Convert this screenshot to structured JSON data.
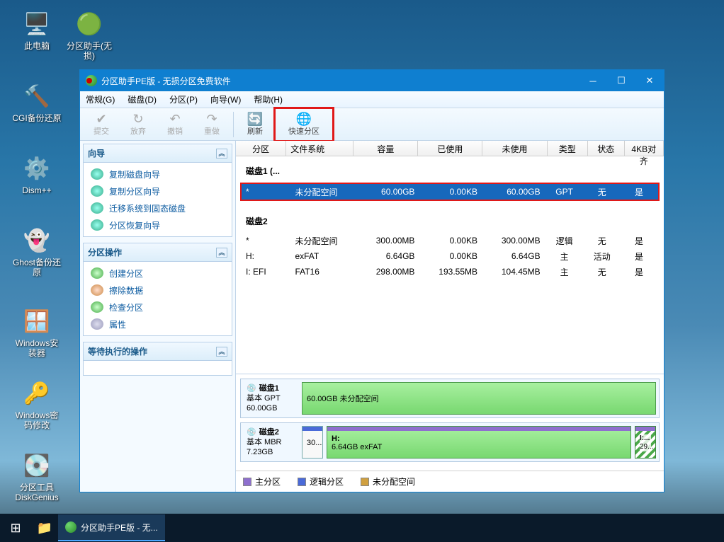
{
  "desktop": {
    "icons": [
      {
        "label": "此电脑"
      },
      {
        "label": "分区助手(无损)"
      },
      {
        "label": "CGI备份还原"
      },
      {
        "label": "Dism++"
      },
      {
        "label": "Ghost备份还原"
      },
      {
        "label": "Windows安装器"
      },
      {
        "label": "Windows密码修改"
      },
      {
        "label": "分区工具DiskGenius"
      }
    ]
  },
  "window": {
    "title": "分区助手PE版 - 无损分区免费软件"
  },
  "menu": {
    "m0": "常规(G)",
    "m1": "磁盘(D)",
    "m2": "分区(P)",
    "m3": "向导(W)",
    "m4": "帮助(H)"
  },
  "toolbar": {
    "commit": "提交",
    "discard": "放弃",
    "undo": "撤销",
    "redo": "重做",
    "refresh": "刷新",
    "quick": "快速分区"
  },
  "left": {
    "wizard": {
      "title": "向导",
      "i0": "复制磁盘向导",
      "i1": "复制分区向导",
      "i2": "迁移系统到固态磁盘",
      "i3": "分区恢复向导"
    },
    "ops": {
      "title": "分区操作",
      "i0": "创建分区",
      "i1": "擦除数据",
      "i2": "检查分区",
      "i3": "属性"
    },
    "pending": {
      "title": "等待执行的操作"
    }
  },
  "cols": {
    "c0": "分区",
    "c1": "文件系统",
    "c2": "容量",
    "c3": "已使用",
    "c4": "未使用",
    "c5": "类型",
    "c6": "状态",
    "c7": "4KB对齐"
  },
  "disks": {
    "d1": {
      "title": "磁盘1 (...",
      "r0": {
        "c0": "*",
        "c1": "未分配空间",
        "c2": "60.00GB",
        "c3": "0.00KB",
        "c4": "60.00GB",
        "c5": "GPT",
        "c6": "无",
        "c7": "是"
      }
    },
    "d2": {
      "title": "磁盘2",
      "r0": {
        "c0": "*",
        "c1": "未分配空间",
        "c2": "300.00MB",
        "c3": "0.00KB",
        "c4": "300.00MB",
        "c5": "逻辑",
        "c6": "无",
        "c7": "是"
      },
      "r1": {
        "c0": "H:",
        "c1": "exFAT",
        "c2": "6.64GB",
        "c3": "0.00KB",
        "c4": "6.64GB",
        "c5": "主",
        "c6": "活动",
        "c7": "是"
      },
      "r2": {
        "c0": "I: EFI",
        "c1": "FAT16",
        "c2": "298.00MB",
        "c3": "193.55MB",
        "c4": "104.45MB",
        "c5": "主",
        "c6": "无",
        "c7": "是"
      }
    }
  },
  "map": {
    "d1": {
      "name": "磁盘1",
      "type": "基本 GPT",
      "size": "60.00GB",
      "blk0": "60.00GB 未分配空间"
    },
    "d2": {
      "name": "磁盘2",
      "type": "基本 MBR",
      "size": "7.23GB",
      "b0a": "30...",
      "b1a": "H:",
      "b1b": "6.64GB exFAT",
      "b2a": "I:...",
      "b2b": "29..."
    }
  },
  "legend": {
    "l0": "主分区",
    "l1": "逻辑分区",
    "l2": "未分配空间"
  },
  "taskbar": {
    "app": "分区助手PE版 - 无..."
  }
}
